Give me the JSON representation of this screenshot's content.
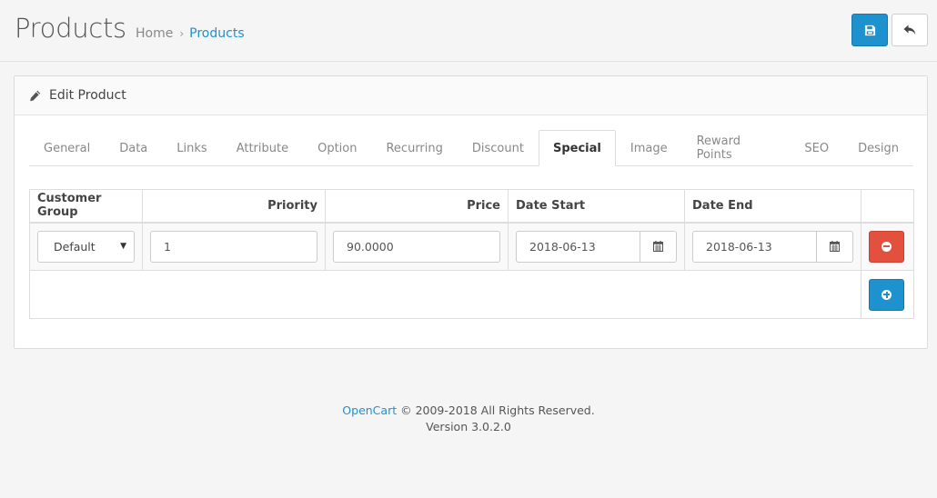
{
  "header": {
    "title": "Products",
    "breadcrumb": [
      {
        "label": "Home"
      },
      {
        "label": "Products"
      }
    ],
    "breadcrumb_separator": "›",
    "save_icon": "floppy-disk-icon",
    "back_icon": "reply-arrow-icon"
  },
  "panel": {
    "title": "Edit Product",
    "icon": "pencil-icon"
  },
  "tabs": [
    {
      "label": "General",
      "active": false
    },
    {
      "label": "Data",
      "active": false
    },
    {
      "label": "Links",
      "active": false
    },
    {
      "label": "Attribute",
      "active": false
    },
    {
      "label": "Option",
      "active": false
    },
    {
      "label": "Recurring",
      "active": false
    },
    {
      "label": "Discount",
      "active": false
    },
    {
      "label": "Special",
      "active": true
    },
    {
      "label": "Image",
      "active": false
    },
    {
      "label": "Reward Points",
      "active": false
    },
    {
      "label": "SEO",
      "active": false
    },
    {
      "label": "Design",
      "active": false
    }
  ],
  "special_table": {
    "columns": [
      "Customer Group",
      "Priority",
      "Price",
      "Date Start",
      "Date End"
    ],
    "rows": [
      {
        "customer_group": "Default",
        "priority": "1",
        "price": "90.0000",
        "date_start": "2018-06-13",
        "date_end": "2018-06-13"
      }
    ],
    "calendar_icon": "calendar-icon",
    "remove_icon": "minus-circle-icon",
    "add_icon": "plus-circle-icon"
  },
  "footer": {
    "brand": "OpenCart",
    "copyright": " © 2009-2018 All Rights Reserved.",
    "version": "Version 3.0.2.0"
  },
  "colors": {
    "primary": "#1e91cf",
    "danger": "#e3503e",
    "background": "#f5f5f5"
  }
}
